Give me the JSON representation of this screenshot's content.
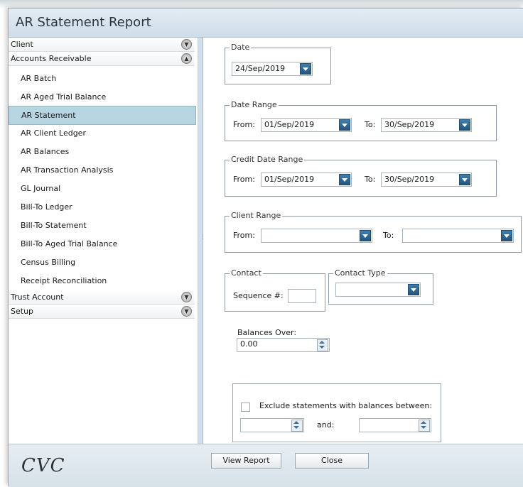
{
  "window": {
    "title": "AR Statement Report"
  },
  "nav": {
    "categories": [
      {
        "label": "Client"
      },
      {
        "label": "Accounts Receivable"
      },
      {
        "label": "Trust Account"
      },
      {
        "label": "Setup"
      }
    ],
    "items": [
      {
        "label": "AR Batch"
      },
      {
        "label": "AR Aged Trial Balance"
      },
      {
        "label": "AR Statement",
        "selected": true
      },
      {
        "label": "AR Client Ledger"
      },
      {
        "label": "AR Balances"
      },
      {
        "label": "AR Transaction Analysis"
      },
      {
        "label": "GL Journal"
      },
      {
        "label": "Bill-To Ledger"
      },
      {
        "label": "Bill-To Statement"
      },
      {
        "label": "Bill-To Aged Trial Balance"
      },
      {
        "label": "Census Billing"
      },
      {
        "label": "Receipt Reconciliation"
      }
    ]
  },
  "form": {
    "date": {
      "legend": "Date",
      "value": "24/Sep/2019"
    },
    "date_range": {
      "legend": "Date Range",
      "from_label": "From:",
      "from": "01/Sep/2019",
      "to_label": "To:",
      "to": "30/Sep/2019"
    },
    "credit_date_range": {
      "legend": "Credit Date Range",
      "from_label": "From:",
      "from": "01/Sep/2019",
      "to_label": "To:",
      "to": "30/Sep/2019"
    },
    "client_range": {
      "legend": "Client Range",
      "from_label": "From:",
      "from": "",
      "to_label": "To:",
      "to": ""
    },
    "contact": {
      "legend": "Contact",
      "seq_label": "Sequence #:",
      "seq": ""
    },
    "contact_type": {
      "legend": "Contact Type",
      "value": ""
    },
    "balances_over": {
      "label": "Balances Over:",
      "value": "0.00"
    },
    "exclude": {
      "label": "Exclude statements with balances between:",
      "and_label": "and:",
      "low": "",
      "high": ""
    }
  },
  "footer": {
    "logo_text": "CVC",
    "view_report": "View Report",
    "close": "Close"
  }
}
